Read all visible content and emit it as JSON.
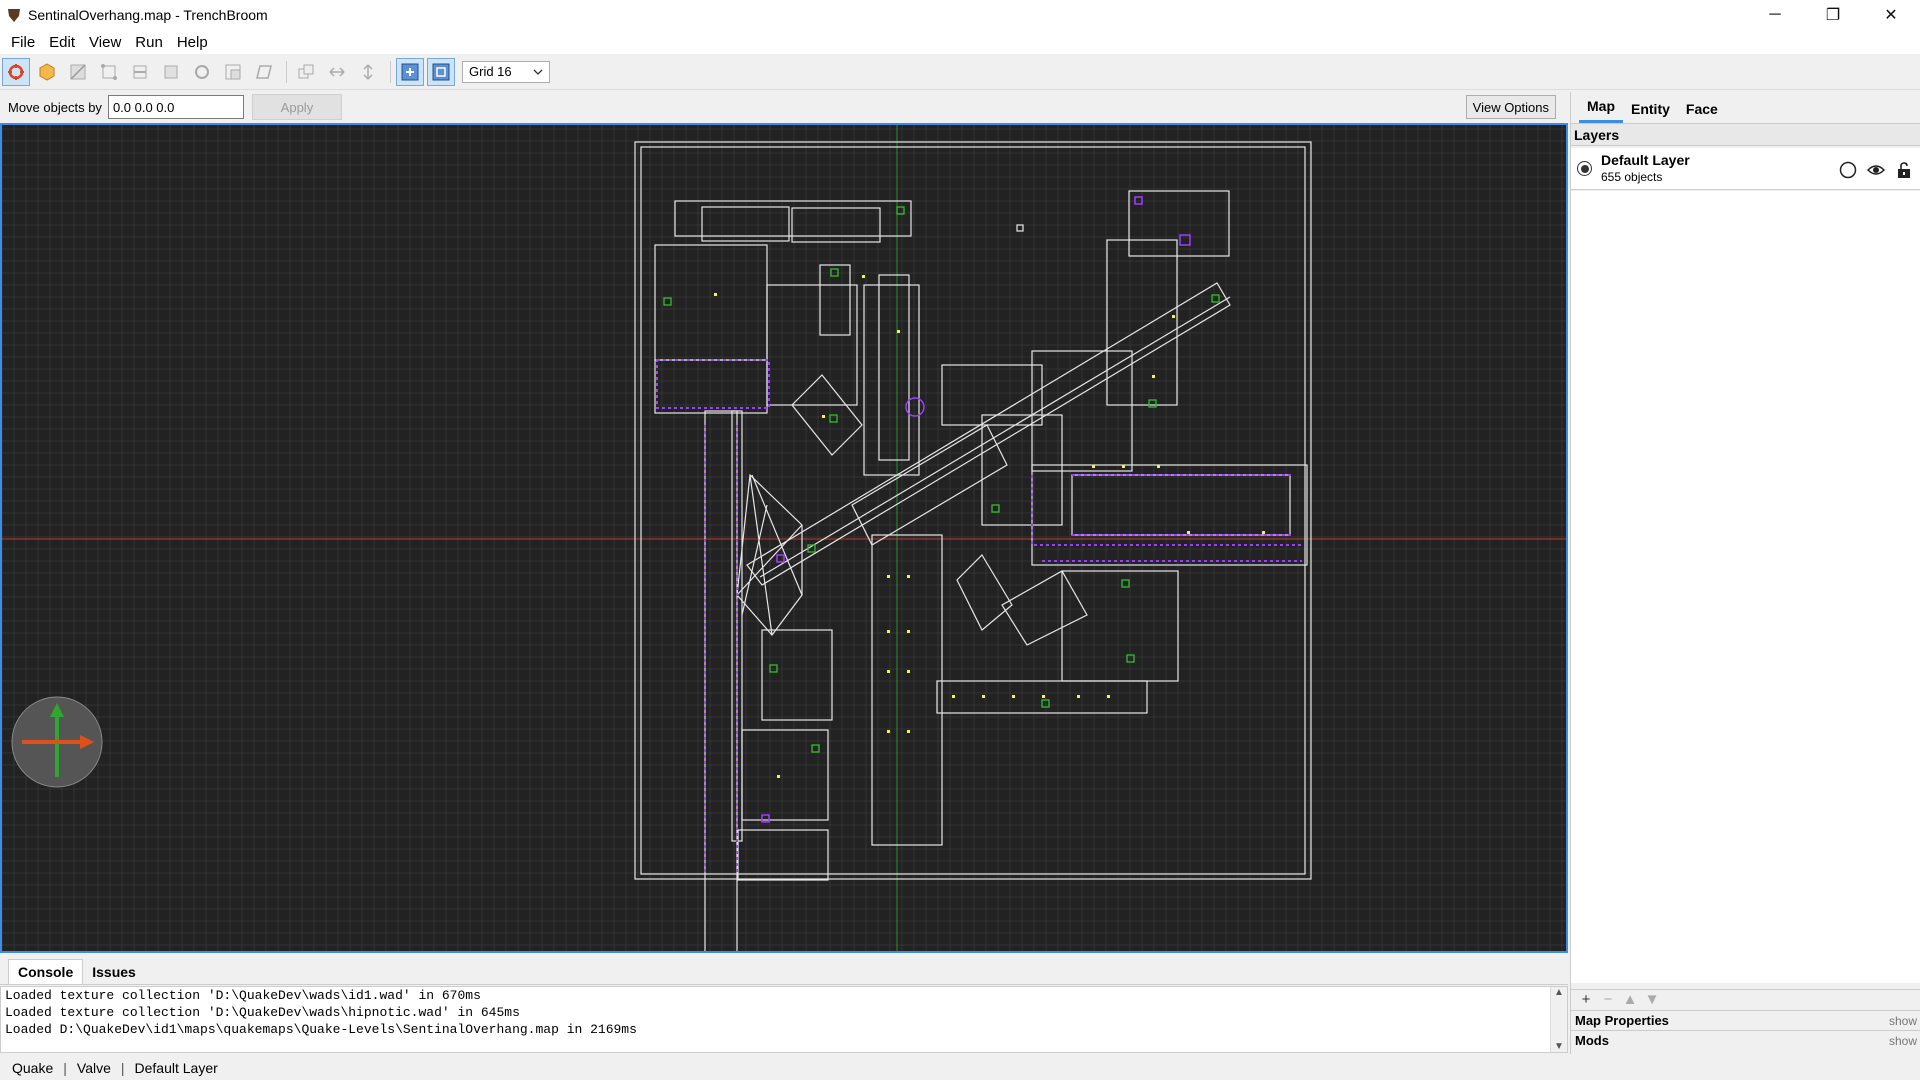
{
  "window": {
    "title": "SentinalOverhang.map - TrenchBroom",
    "minimize": "─",
    "restore": "❐",
    "close": "✕"
  },
  "menu": [
    "File",
    "Edit",
    "View",
    "Run",
    "Help"
  ],
  "toolbar": {
    "tools": [
      "select-tool-icon",
      "brush-tool-icon",
      "clip-tool-icon",
      "vertex-tool-icon",
      "edge-tool-icon",
      "face-tool-icon",
      "rotate-tool-icon",
      "scale-tool-icon",
      "shear-tool-icon",
      "duplicate-icon",
      "flip-horizontal-icon",
      "flip-vertical-icon",
      "texture-lock-icon",
      "uv-lock-icon"
    ],
    "grid_label": "Grid 16"
  },
  "movebar": {
    "label": "Move objects by",
    "value": "0.0 0.0 0.0",
    "apply": "Apply",
    "view_options": "View Options"
  },
  "console": {
    "tabs": [
      "Console",
      "Issues"
    ],
    "lines": [
      "Loaded texture collection 'D:\\QuakeDev\\wads\\id1.wad' in 670ms",
      "Loaded texture collection 'D:\\QuakeDev\\wads\\hipnotic.wad' in 645ms",
      "Loaded D:\\QuakeDev\\id1\\maps\\quakemaps\\Quake-Levels\\SentinalOverhang.map in 2169ms"
    ]
  },
  "status": [
    "Quake",
    "Valve",
    "Default Layer"
  ],
  "side": {
    "tabs": [
      "Map",
      "Entity",
      "Face"
    ],
    "layers_title": "Layers",
    "layer": {
      "name": "Default Layer",
      "count": "655 objects"
    },
    "map_properties": "Map Properties",
    "mods": "Mods",
    "show": "show"
  },
  "colors": {
    "viewport_bg": "#222222",
    "grid": "#3a3a3a",
    "brush_outline": "#e6e6e6",
    "axis_x": "#c0392b",
    "axis_y": "#2e8b2e",
    "entity": "#9b40ff",
    "light": "#f5f53d",
    "accent": "#3a8ee6"
  }
}
